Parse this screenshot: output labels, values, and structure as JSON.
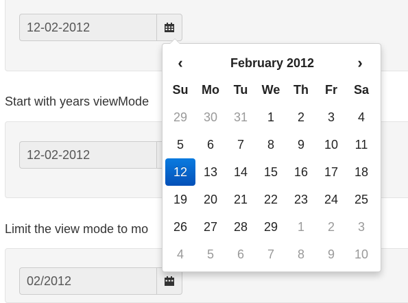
{
  "sections": [
    {
      "date_value": "12-02-2012"
    },
    {
      "label": "Start with years viewMode",
      "date_value": "12-02-2012"
    },
    {
      "label": "Limit the view mode to mo",
      "date_value": "02/2012"
    }
  ],
  "icons": {
    "calendar": "calendar-icon"
  },
  "calendar": {
    "title": "February 2012",
    "prev": "‹",
    "next": "›",
    "days_of_week": [
      "Su",
      "Mo",
      "Tu",
      "We",
      "Th",
      "Fr",
      "Sa"
    ],
    "weeks": [
      [
        {
          "d": "29",
          "m": true
        },
        {
          "d": "30",
          "m": true
        },
        {
          "d": "31",
          "m": true
        },
        {
          "d": "1"
        },
        {
          "d": "2"
        },
        {
          "d": "3"
        },
        {
          "d": "4"
        }
      ],
      [
        {
          "d": "5"
        },
        {
          "d": "6"
        },
        {
          "d": "7"
        },
        {
          "d": "8"
        },
        {
          "d": "9"
        },
        {
          "d": "10"
        },
        {
          "d": "11"
        }
      ],
      [
        {
          "d": "12",
          "active": true
        },
        {
          "d": "13"
        },
        {
          "d": "14"
        },
        {
          "d": "15"
        },
        {
          "d": "16"
        },
        {
          "d": "17"
        },
        {
          "d": "18"
        }
      ],
      [
        {
          "d": "19"
        },
        {
          "d": "20"
        },
        {
          "d": "21"
        },
        {
          "d": "22"
        },
        {
          "d": "23"
        },
        {
          "d": "24"
        },
        {
          "d": "25"
        }
      ],
      [
        {
          "d": "26"
        },
        {
          "d": "27"
        },
        {
          "d": "28"
        },
        {
          "d": "29"
        },
        {
          "d": "1",
          "m": true
        },
        {
          "d": "2",
          "m": true
        },
        {
          "d": "3",
          "m": true
        }
      ],
      [
        {
          "d": "4",
          "m": true
        },
        {
          "d": "5",
          "m": true
        },
        {
          "d": "6",
          "m": true
        },
        {
          "d": "7",
          "m": true
        },
        {
          "d": "8",
          "m": true
        },
        {
          "d": "9",
          "m": true
        },
        {
          "d": "10",
          "m": true
        }
      ]
    ],
    "active_color": "#0a6fd8"
  }
}
